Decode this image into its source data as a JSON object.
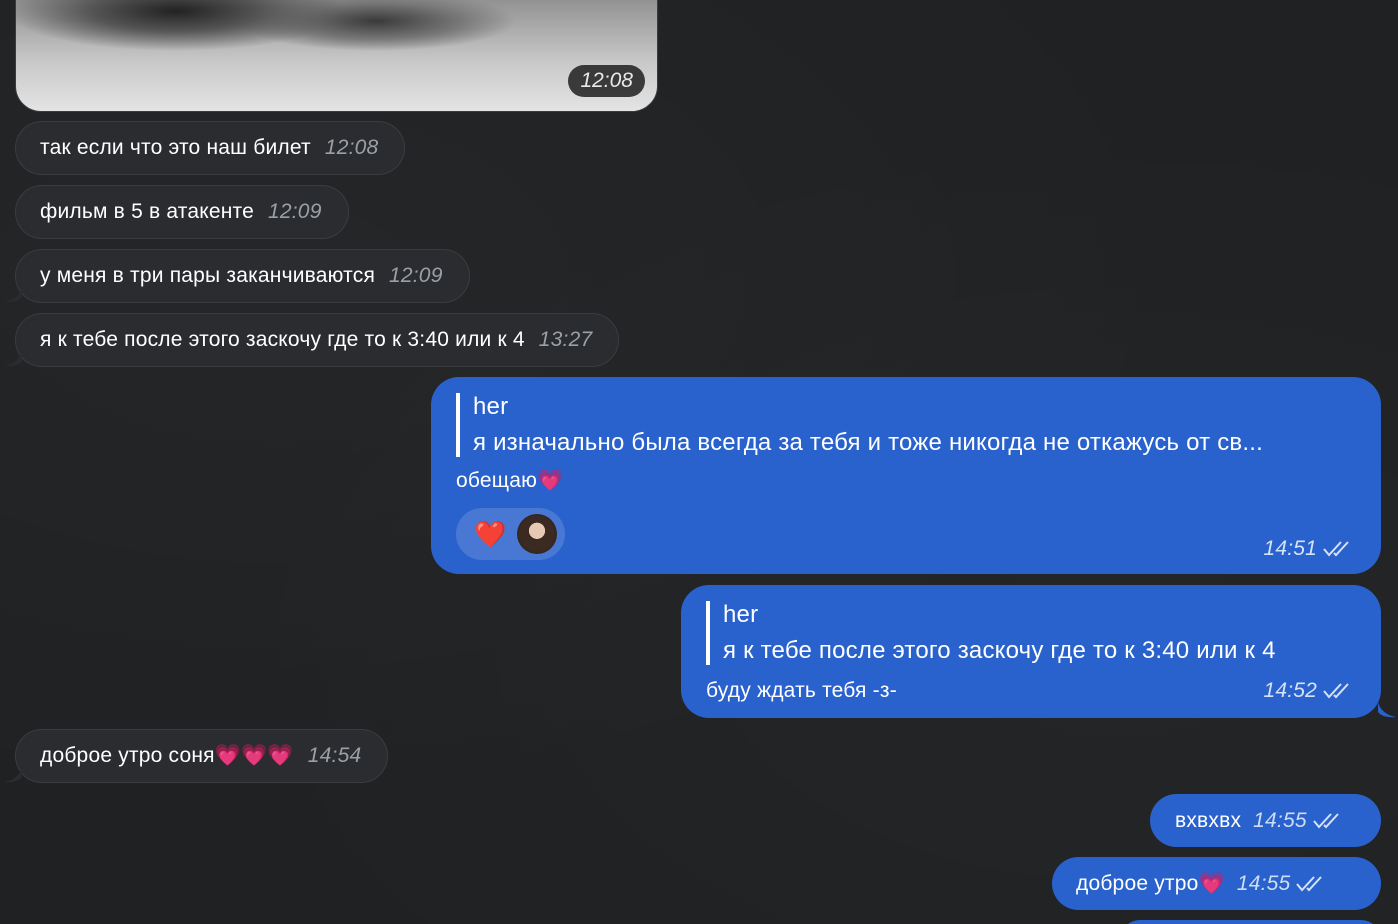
{
  "photo_message": {
    "time": "12:08"
  },
  "incoming": [
    {
      "text": "так если что это наш билет",
      "time": "12:08"
    },
    {
      "text": "фильм в 5 в атакенте",
      "time": "12:09"
    },
    {
      "text": "у меня в три пары заканчиваются",
      "time": "12:09"
    },
    {
      "text": "я к тебе после этого заскочу где то к 3:40 или к 4",
      "time": "13:27"
    }
  ],
  "outgoing_reply_1": {
    "reply_name": "her",
    "reply_text": "я изначально была всегда за тебя и тоже никогда не откажусь от св...",
    "text": "обещаю💗",
    "reaction": "❤️",
    "time": "14:51"
  },
  "outgoing_reply_2": {
    "reply_name": "her",
    "reply_text": "я к тебе после этого заскочу где то к 3:40 или к 4",
    "text": "буду ждать тебя -з-",
    "time": "14:52"
  },
  "incoming_2": {
    "text": "доброе утро соня💗💗💗",
    "time": "14:54"
  },
  "outgoing_simple": [
    {
      "text": "вхвхвх",
      "time": "14:55"
    },
    {
      "text": "доброе утро💗",
      "time": "14:55"
    }
  ],
  "icons": {
    "read": "double-check-icon",
    "reaction": "heart-icon",
    "reactor": "avatar"
  },
  "colors": {
    "background": "#1f2123",
    "incoming_bubble": "#2a2c2f",
    "outgoing_bubble": "#2a62cd"
  }
}
